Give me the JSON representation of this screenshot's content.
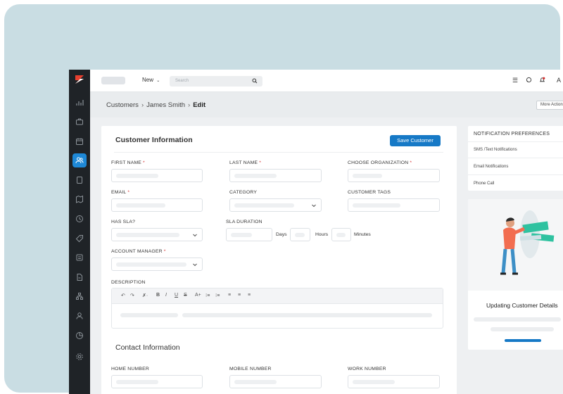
{
  "topbar": {
    "new_label": "New",
    "search_placeholder": "Search",
    "avatar_initial": "A"
  },
  "breadcrumb": {
    "items": [
      "Customers",
      "James Smith"
    ],
    "current": "Edit",
    "more_label": "More Actions"
  },
  "form": {
    "title": "Customer Information",
    "save_label": "Save Customer",
    "fields": {
      "first_name": "FIRST NAME",
      "last_name": "LAST NAME",
      "organization": "CHOOSE ORGANIZATION",
      "email": "EMAIL",
      "category": "CATEGORY",
      "customer_tags": "CUSTOMER TAGS",
      "has_sla": "HAS SLA?",
      "sla_duration": "SLA DURATION",
      "account_manager": "ACCOUNT MANAGER",
      "description": "DESCRIPTION"
    },
    "required_mark": "*",
    "units": {
      "days": "Days",
      "hours": "Hours",
      "minutes": "Minutes"
    },
    "editor_toolbar": {
      "undo": "↶",
      "redo": "↷",
      "clear": "✗·",
      "bold": "B",
      "italic": "I",
      "underline": "U",
      "strike": "S",
      "font_size": "A+",
      "ol": "⁝≡",
      "ul": "⁝≡",
      "align_left": "≡",
      "align_center": "≡",
      "align_right": "≡"
    },
    "contact_section_title": "Contact Information",
    "contact_fields": {
      "home": "HOME NUMBER",
      "mobile": "MOBILE NUMBER",
      "work": "WORK NUMBER"
    }
  },
  "notifications": {
    "title": "NOTIFICATION PREFERENCES",
    "items": [
      "SMS /Text Notifications",
      "Email Notifications",
      "Phone Call"
    ]
  },
  "promo": {
    "text": "Updating Customer Details"
  },
  "colors": {
    "accent": "#1679c6",
    "sidebar": "#1f2327",
    "active_nav": "#1e88d6",
    "required": "#d32f2f"
  },
  "sidebar_icons": [
    "analytics-icon",
    "briefcase-icon",
    "calendar-icon",
    "customers-icon",
    "book-icon",
    "map-icon",
    "clock-icon",
    "tag-icon",
    "report-icon",
    "document-icon",
    "hierarchy-icon",
    "user-icon",
    "pie-chart-icon",
    "settings-icon"
  ]
}
